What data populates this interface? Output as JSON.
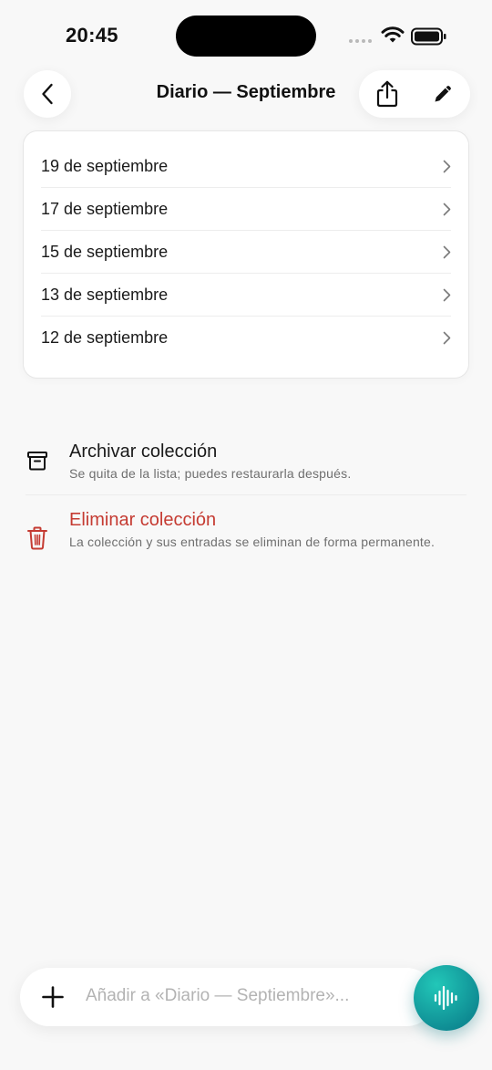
{
  "status_bar": {
    "time": "20:45"
  },
  "nav": {
    "title": "Diario — Septiembre"
  },
  "entries": [
    {
      "label": "19 de septiembre"
    },
    {
      "label": "17 de septiembre"
    },
    {
      "label": "15 de septiembre"
    },
    {
      "label": "13 de septiembre"
    },
    {
      "label": "12 de septiembre"
    }
  ],
  "actions": {
    "archive": {
      "title": "Archivar colección",
      "description": "Se quita de la lista; puedes restaurarla después."
    },
    "delete": {
      "title": "Eliminar colección",
      "description": "La colección y sus entradas se eliminan de forma permanente."
    }
  },
  "composer": {
    "placeholder": "Añadir a «Diario — Septiembre»..."
  },
  "colors": {
    "danger": "#c53b32",
    "mic_accent": "#12a3a3",
    "background": "#f8f8f8"
  },
  "icons": {
    "back": "chevron-left-icon",
    "share": "share-icon",
    "edit": "pencil-icon",
    "archive": "archive-box-icon",
    "delete": "trash-icon",
    "add": "plus-icon",
    "voice": "waveform-icon"
  }
}
